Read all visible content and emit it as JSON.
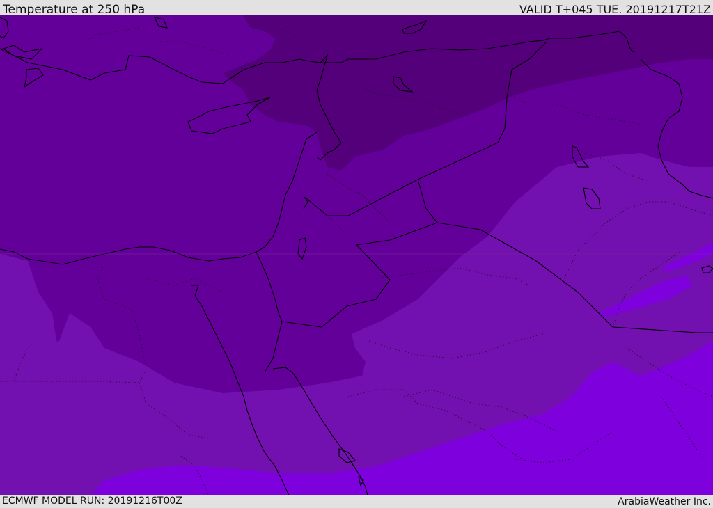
{
  "header": {
    "title": "Temperature at 250 hPa",
    "valid": "VALID T+045 TUE. 20191217T21Z"
  },
  "footer": {
    "model_run": "ECMWF MODEL RUN: 20191216T00Z",
    "brand": "ArabiaWeather Inc."
  },
  "colors": {
    "band_coldest": "#53007a",
    "band_cold": "#64009a",
    "band_mid": "#7310b0",
    "band_warm": "#7e00dc",
    "border_solid": "#000000",
    "border_dotted": "#2a1035",
    "bar_bg": "#e2e2e2"
  }
}
